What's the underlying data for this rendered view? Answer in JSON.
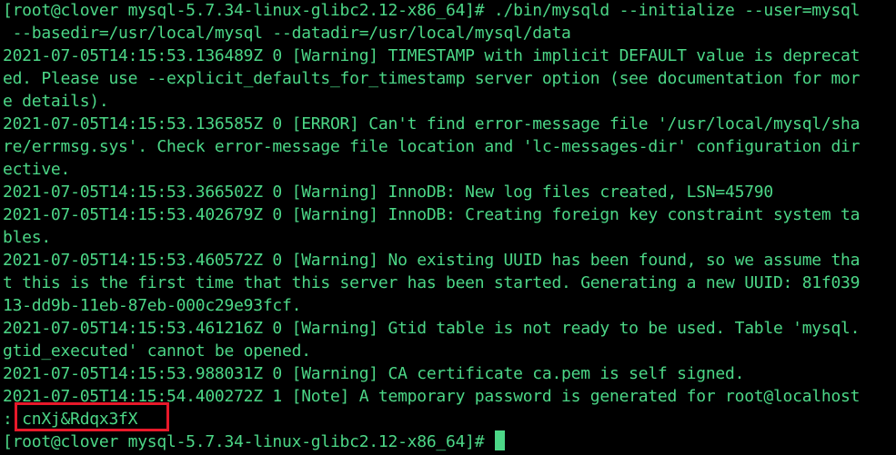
{
  "terminal": {
    "lines": [
      "[root@clover mysql-5.7.34-linux-glibc2.12-x86_64]# ./bin/mysqld --initialize --user=mysql",
      " --basedir=/usr/local/mysql --datadir=/usr/local/mysql/data",
      "2021-07-05T14:15:53.136489Z 0 [Warning] TIMESTAMP with implicit DEFAULT value is deprecat",
      "ed. Please use --explicit_defaults_for_timestamp server option (see documentation for mor",
      "e details).",
      "2021-07-05T14:15:53.136585Z 0 [ERROR] Can't find error-message file '/usr/local/mysql/sha",
      "re/errmsg.sys'. Check error-message file location and 'lc-messages-dir' configuration dir",
      "ective.",
      "2021-07-05T14:15:53.366502Z 0 [Warning] InnoDB: New log files created, LSN=45790",
      "2021-07-05T14:15:53.402679Z 0 [Warning] InnoDB: Creating foreign key constraint system ta",
      "bles.",
      "2021-07-05T14:15:53.460572Z 0 [Warning] No existing UUID has been found, so we assume tha",
      "t this is the first time that this server has been started. Generating a new UUID: 81f039",
      "13-dd9b-11eb-87eb-000c29e93fcf.",
      "2021-07-05T14:15:53.461216Z 0 [Warning] Gtid table is not ready to be used. Table 'mysql.",
      "gtid_executed' cannot be opened.",
      "2021-07-05T14:15:53.988031Z 0 [Warning] CA certificate ca.pem is self signed.",
      "2021-07-05T14:15:54.400272Z 1 [Note] A temporary password is generated for root@localhost",
      ": cnXj&Rdqx3fX"
    ],
    "prompt": "[root@clover mysql-5.7.34-linux-glibc2.12-x86_64]# ",
    "text_color": "#4cd787",
    "background_color": "#000000",
    "highlight_color": "#e8192a"
  }
}
